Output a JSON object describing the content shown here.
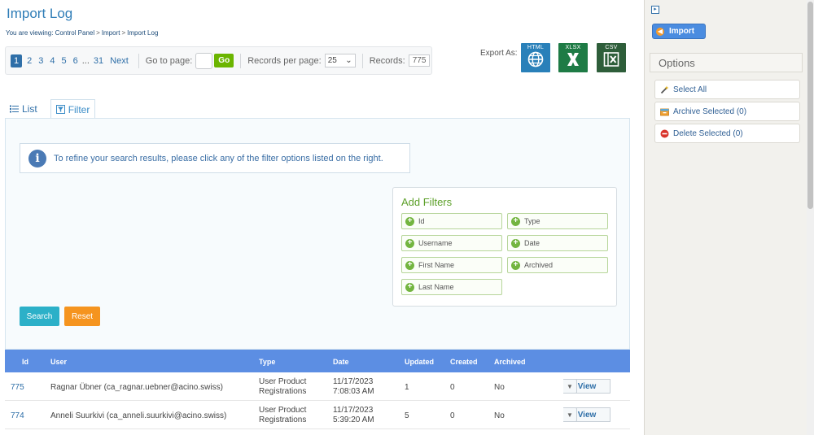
{
  "page": {
    "title": "Import Log",
    "breadcrumb_prefix": "You are viewing:",
    "breadcrumb": [
      "Control Panel",
      "Import",
      "Import Log"
    ]
  },
  "pager": {
    "pages": [
      "1",
      "2",
      "3",
      "4",
      "5",
      "6"
    ],
    "ellipsis": "...",
    "last_page": "31",
    "next": "Next",
    "goto_label": "Go to page:",
    "go_label": "Go",
    "rpp_label": "Records per page:",
    "rpp_value": "25",
    "records_label": "Records:",
    "records_value": "775"
  },
  "export": {
    "label": "Export As:",
    "html": "HTML",
    "xlsx": "XLSX",
    "csv": "CSV"
  },
  "tabs": {
    "list": "List",
    "filter": "Filter"
  },
  "filter": {
    "info": "To refine your search results, please click any of the filter options listed on the right.",
    "add_filters_title": "Add Filters",
    "options": [
      "Id",
      "Type",
      "Username",
      "Date",
      "First Name",
      "Archived",
      "Last Name"
    ],
    "search_label": "Search",
    "reset_label": "Reset"
  },
  "grid": {
    "columns": [
      "Id",
      "User",
      "Type",
      "Date",
      "Updated",
      "Created",
      "Archived"
    ],
    "rows": [
      {
        "id": "775",
        "user": "Ragnar Übner (ca_ragnar.uebner@acino.swiss)",
        "type_line1": "User Product",
        "type_line2": "Registrations",
        "date_line1": "11/17/2023",
        "date_line2": "7:08:03 AM",
        "updated": "1",
        "created": "0",
        "archived": "No",
        "action": "View"
      },
      {
        "id": "774",
        "user": "Anneli Suurkivi (ca_anneli.suurkivi@acino.swiss)",
        "type_line1": "User Product",
        "type_line2": "Registrations",
        "date_line1": "11/17/2023",
        "date_line2": "5:39:20 AM",
        "updated": "5",
        "created": "0",
        "archived": "No",
        "action": "View"
      }
    ]
  },
  "sidebar": {
    "import_label": "Import",
    "options_title": "Options",
    "items": [
      "Select All",
      "Archive Selected (0)",
      "Delete Selected (0)"
    ]
  },
  "colors": {
    "accent_blue": "#2f7db7",
    "grid_header": "#5c8ee3",
    "go_green": "#6bb500",
    "search_teal": "#2cb0c8",
    "reset_orange": "#f5941f"
  }
}
